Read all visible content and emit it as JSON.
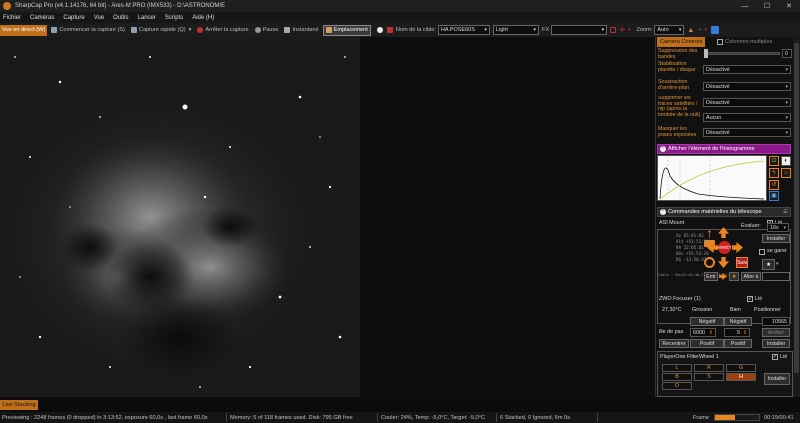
{
  "window": {
    "title": "SharpCap Pro (v4.1.14176, 64 bit) - Ares-M PRO (IMX533) - D:\\ASTRONOMIE",
    "minimize": "—",
    "maximize": "☐",
    "close": "✕"
  },
  "menu": [
    "Fichier",
    "Caméras",
    "Capture",
    "Vue",
    "Outils",
    "Lancer",
    "Scripts",
    "Aide (H)"
  ],
  "toolbar": {
    "live_view": "Vue en direct (W)",
    "start_capture": "Commencer la capture (S)",
    "quick_capture": "Capture rapide (Q)",
    "stop_capture": "Arrêter la capture",
    "pause": "Pause",
    "snapshot": "Instantané",
    "placement": "Emplacement",
    "target_label": "Nom de la cible:",
    "target_value": "HA POSE60S",
    "frame_type": "Light",
    "fx_label": "FX",
    "fx_value": "",
    "zoom_label": "Zoom:",
    "zoom_value": "Auto"
  },
  "panel": {
    "tab_camera": "Camera Controls",
    "tab_multi": "Colonnes multiples",
    "rows": [
      {
        "label": "Suppression des bandes",
        "value": "0",
        "kind": "slider"
      },
      {
        "label": "Stabilisation planète / disque",
        "value": "Désactivé"
      },
      {
        "label": "Soustraction d'arrière-plan",
        "value": "Désactivé"
      },
      {
        "label": "Supprimer les traces satellites / nip (après la tombée de la nuit)",
        "value": "Désactivé"
      },
      {
        "label": "Masquer les poses exposées",
        "value": "Aucun"
      },
      {
        "label": "",
        "value": "Désactivé"
      }
    ],
    "histogram_title": "Afficher l'élément de l'histogramme",
    "telescope_title": "Commandes matérielles du télescope",
    "mount": {
      "name": "ASI Mount",
      "link": "Lié",
      "rate_label": "Évaluer:",
      "rate": "16x",
      "install": "Installer",
      "go": "Go",
      "park": "se garer",
      "stop": "ARRÊT",
      "sync": "Suiv",
      "coords": [
        "Az   65:01:02",
        "Alt  +51:51:04",
        "RA   22:05:01",
        "Déc  +55:53:26",
        "RS   -13:58:42"
      ],
      "footer": "Cible : RA=22:45:46,7 Déc=+58:11:58",
      "enter": "Entr",
      "goto": "Aller à"
    },
    "focuser": {
      "name": "ZWO Focuser (1)",
      "link": "Lié",
      "temp": "27,30°C",
      "coarse": "Grossier",
      "fine": "Bien",
      "position_label": "Positionner",
      "position": "10565",
      "neg1": "Négatif",
      "neg2": "Négatif",
      "step_label": "ille de pas",
      "step_coarse": "6000",
      "step_fine": "5",
      "stop": "Arrêter",
      "recenter": "Recentrer",
      "pos1": "Positif",
      "pos2": "Positif",
      "install": "Installer"
    },
    "filterwheel": {
      "name": "PlayerOne FilterWheel 1",
      "link": "Lié",
      "filters": [
        "L",
        "R",
        "G",
        "B",
        "S",
        "H",
        "O"
      ],
      "active": "H",
      "install": "Installer"
    }
  },
  "live_stacking": "Live Stacking",
  "status": {
    "preview": "Previewing : 2248 frames (0 dropped) in 3:13:52, exposure 60,0s , last frame 60,0s",
    "memory": "Memory: 5 of 118 frames used. Disk: 795 GB free",
    "cooler": "Cooler: 24%, Temp: -5,0°C, Target: -5,0°C",
    "stacked": "6 Stacked, 0 Ignored, 6m 0s",
    "frame_label": "Frame",
    "frame_progress": 0.45,
    "time": "00:19/00:41"
  },
  "colors": {
    "accent": "#e88520",
    "histogram_header": "#8a1a8a"
  }
}
